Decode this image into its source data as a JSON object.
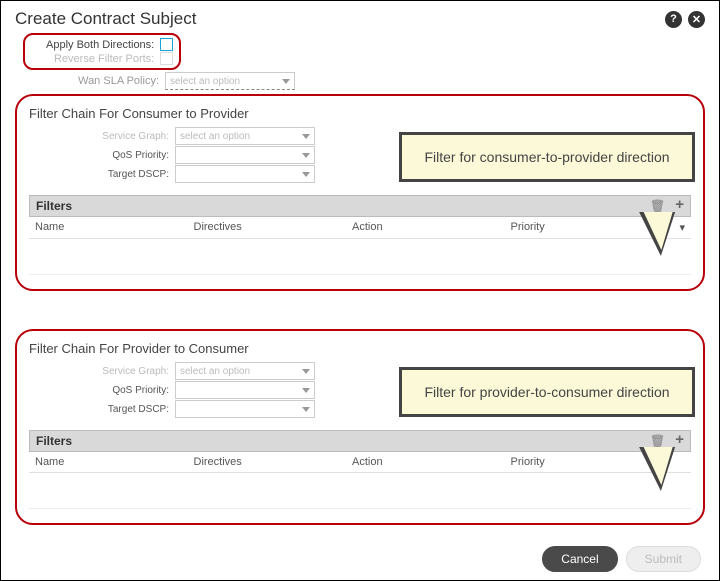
{
  "title": "Create Contract Subject",
  "apply_label": "Apply Both Directions:",
  "reverse_label": "Reverse Filter Ports:",
  "wan_label": "Wan SLA Policy:",
  "select_placeholder": "select an option",
  "chain_c2p": {
    "title": "Filter Chain For Consumer to Provider",
    "service_graph_label": "Service Graph:",
    "qos_label": "QoS Priority:",
    "dscp_label": "Target DSCP:",
    "filters_label": "Filters",
    "cols": {
      "name": "Name",
      "directives": "Directives",
      "action": "Action",
      "priority": "Priority"
    },
    "callout": "Filter for consumer-to-provider direction"
  },
  "chain_p2c": {
    "title": "Filter Chain For Provider to Consumer",
    "service_graph_label": "Service Graph:",
    "qos_label": "QoS Priority:",
    "dscp_label": "Target DSCP:",
    "filters_label": "Filters",
    "cols": {
      "name": "Name",
      "directives": "Directives",
      "action": "Action",
      "priority": "Priority"
    },
    "callout": "Filter for provider-to-consumer direction"
  },
  "buttons": {
    "cancel": "Cancel",
    "submit": "Submit"
  }
}
